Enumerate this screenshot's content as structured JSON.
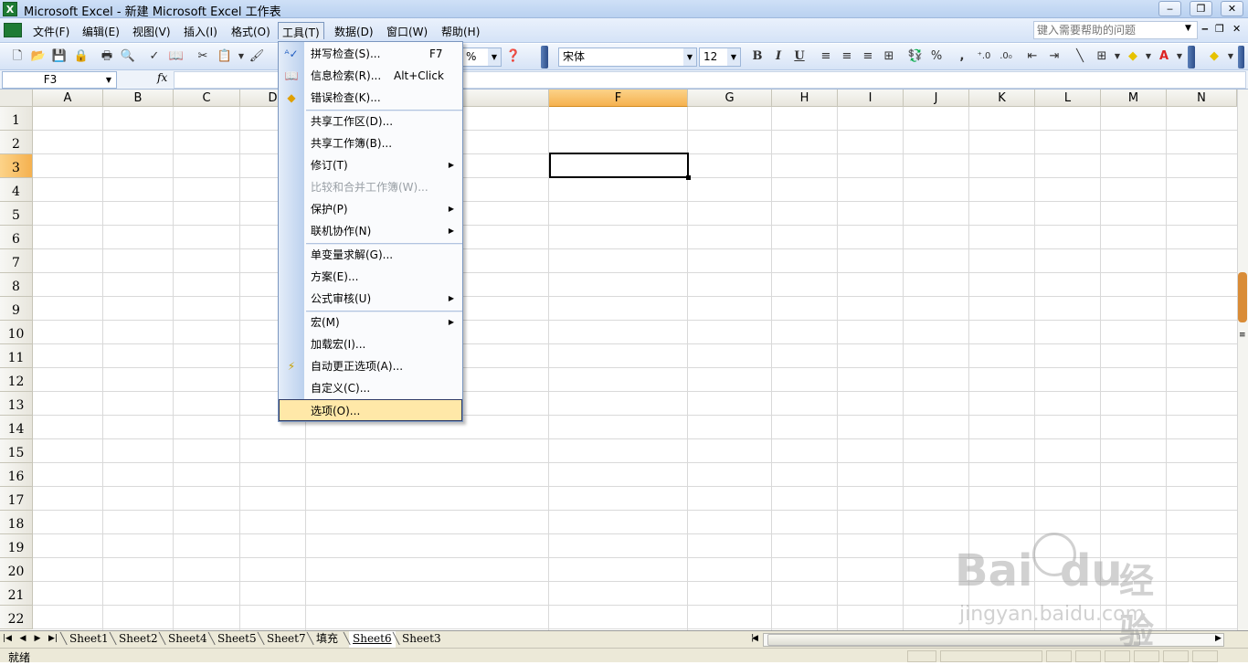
{
  "window": {
    "title": "Microsoft Excel - 新建 Microsoft Excel 工作表",
    "app_icon": "X",
    "buttons": [
      "‒",
      "❐",
      "✕"
    ]
  },
  "menubar": {
    "items": [
      "文件(F)",
      "编辑(E)",
      "视图(V)",
      "插入(I)",
      "格式(O)",
      "工具(T)",
      "数据(D)",
      "窗口(W)",
      "帮助(H)"
    ],
    "help_placeholder": "键入需要帮助的问题",
    "mdi_buttons": [
      "‒",
      "❐",
      "✕"
    ]
  },
  "toolbar": {
    "zoom_partial": "%",
    "font": "宋体",
    "font_size": "12",
    "bold": "B",
    "italic": "I",
    "underline": "U",
    "percent": "%",
    "comma": ","
  },
  "formula_bar": {
    "name_box": "F3",
    "fx": "fx",
    "formula_value": ""
  },
  "grid": {
    "columns": [
      "A",
      "B",
      "C",
      "D",
      "E",
      "F",
      "G",
      "H",
      "I",
      "J",
      "K",
      "L",
      "M",
      "N"
    ],
    "rows": [
      "1",
      "2",
      "3",
      "4",
      "5",
      "6",
      "7",
      "8",
      "9",
      "10",
      "11",
      "12",
      "13",
      "14",
      "15",
      "16",
      "17",
      "18",
      "19",
      "20",
      "21",
      "22"
    ],
    "selected_column": "F",
    "selected_row": "3"
  },
  "tools_menu": {
    "items": [
      {
        "label": "拼写检查(S)...",
        "shortcut": "F7",
        "icon": "spelling-icon"
      },
      {
        "label": "信息检索(R)...",
        "shortcut": "Alt+Click",
        "icon": "research-icon"
      },
      {
        "label": "错误检查(K)...",
        "shortcut": "",
        "icon": "error-check-icon"
      },
      {
        "label": "共享工作区(D)...",
        "shortcut": ""
      },
      {
        "label": "共享工作簿(B)...",
        "shortcut": ""
      },
      {
        "label": "修订(T)",
        "shortcut": "",
        "submenu": true
      },
      {
        "label": "比较和合并工作簿(W)...",
        "shortcut": "",
        "disabled": true
      },
      {
        "label": "保护(P)",
        "shortcut": "",
        "submenu": true
      },
      {
        "label": "联机协作(N)",
        "shortcut": "",
        "submenu": true
      },
      {
        "label": "单变量求解(G)...",
        "shortcut": ""
      },
      {
        "label": "方案(E)...",
        "shortcut": ""
      },
      {
        "label": "公式审核(U)",
        "shortcut": "",
        "submenu": true
      },
      {
        "label": "宏(M)",
        "shortcut": "",
        "submenu": true
      },
      {
        "label": "加载宏(I)...",
        "shortcut": ""
      },
      {
        "label": "自动更正选项(A)...",
        "shortcut": "",
        "icon": "autocorrect-icon"
      },
      {
        "label": "自定义(C)...",
        "shortcut": ""
      },
      {
        "label": "选项(O)...",
        "shortcut": "",
        "highlighted": true
      }
    ]
  },
  "sheet_tabs": [
    "Sheet1",
    "Sheet2",
    "Sheet4",
    "Sheet5",
    "Sheet7",
    "填充",
    "Sheet6",
    "Sheet3"
  ],
  "active_sheet": "Sheet6",
  "status": "就绪",
  "watermark": {
    "brand": "Bai",
    "brand2": "du",
    "suffix": "经验",
    "url": "jingyan.baidu.com"
  }
}
